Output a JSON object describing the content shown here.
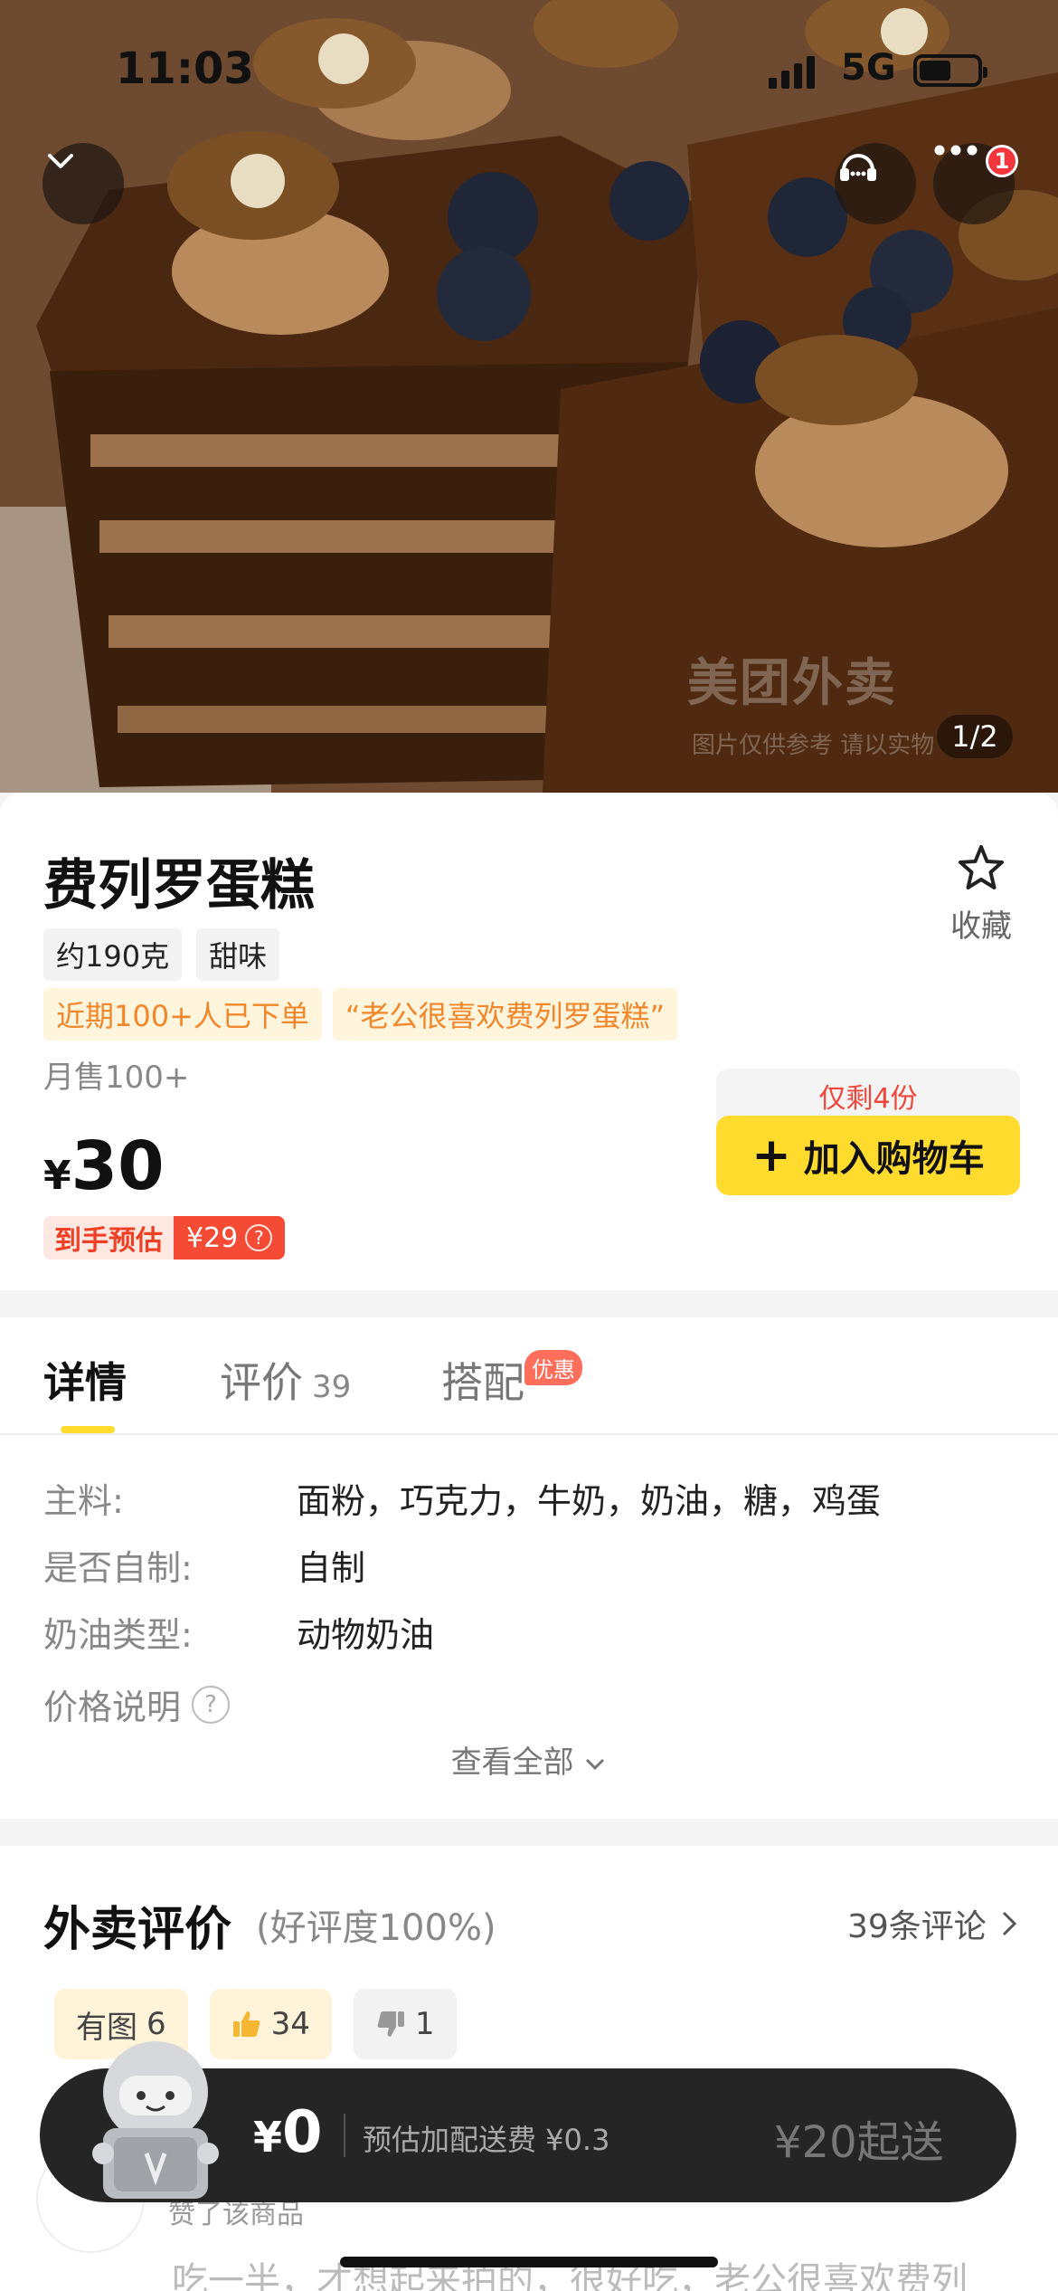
{
  "status_bar": {
    "time": "11:03",
    "network": "5G"
  },
  "hero": {
    "watermark": "美团外卖",
    "watermark_sub": "图片仅供参考 请以实物",
    "page_indicator": "1/2",
    "more_badge": "1"
  },
  "product": {
    "title": "费列罗蛋糕",
    "favorite_label": "收藏",
    "tags": [
      "约190克",
      "甜味"
    ],
    "highlight_tags": [
      "近期100+人已下单",
      "“老公很喜欢费列罗蛋糕”"
    ],
    "monthly_sales": "月售100+",
    "price_symbol": "¥",
    "price": "30",
    "estimate_label": "到手预估",
    "estimate_price": "¥29",
    "stock_note": "仅剩4份",
    "add_to_cart": "加入购物车"
  },
  "tabs": {
    "detail": "详情",
    "review": "评价",
    "review_count": "39",
    "combo": "搭配",
    "combo_badge": "优惠"
  },
  "attributes": [
    {
      "key": "主料:",
      "value": "面粉，巧克力，牛奶，奶油，糖，鸡蛋"
    },
    {
      "key": "是否自制:",
      "value": "自制"
    },
    {
      "key": "奶油类型:",
      "value": "动物奶油"
    }
  ],
  "price_note_label": "价格说明",
  "see_all": "查看全部",
  "reviews": {
    "title": "外卖评价",
    "rating": "(好评度100%)",
    "count_link": "39条评论",
    "filters": [
      {
        "label": "有图",
        "count": "6"
      },
      {
        "label": "",
        "count": "34"
      },
      {
        "label": "",
        "count": "1"
      }
    ],
    "user_strip": "赞了该商品",
    "text": "吃一半，才想起来拍的，很好吃，老公很喜欢费列"
  },
  "cart_bar": {
    "price_symbol": "¥",
    "price": "0",
    "fee_note": "预估加配送费 ¥0.3",
    "min_order": "¥20起送"
  },
  "colors": {
    "accent_yellow": "#fedb2d",
    "price_red": "#f54b34",
    "tag_orange": "#f2862a",
    "cart_bar": "#252525"
  }
}
